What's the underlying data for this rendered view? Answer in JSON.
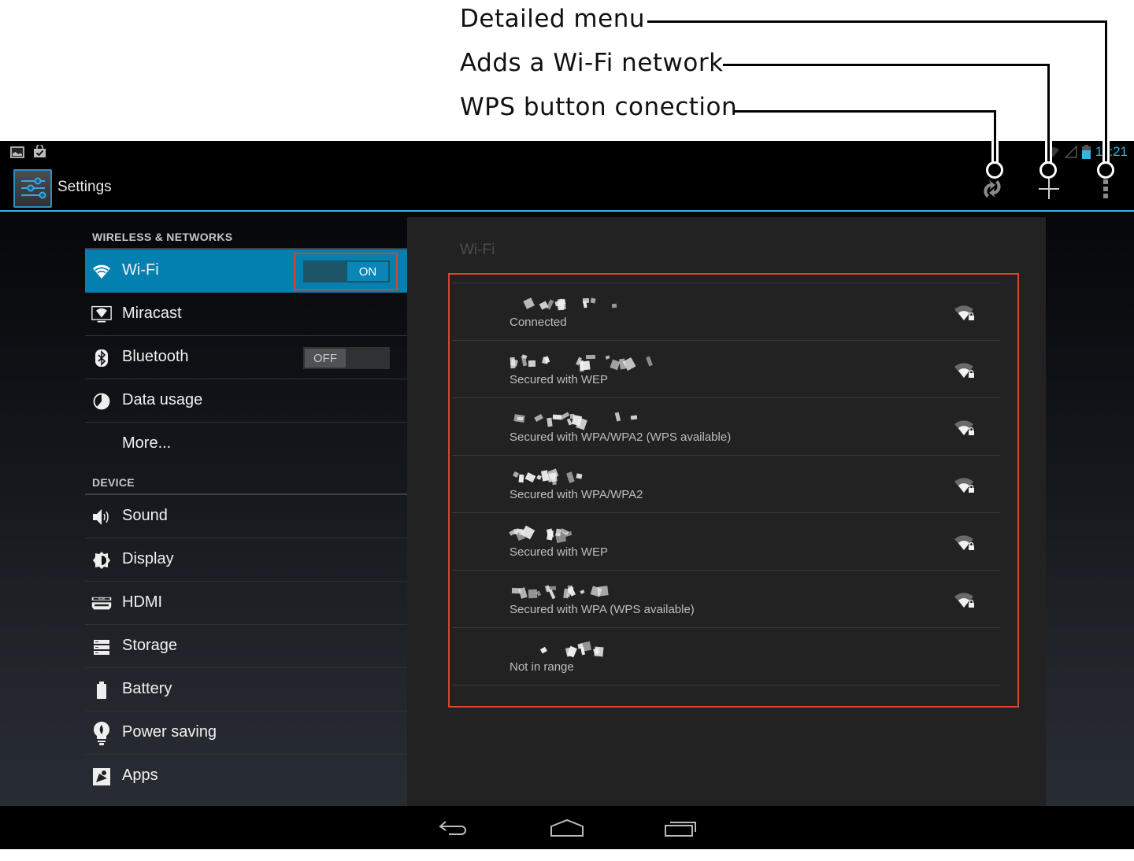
{
  "annotations": [
    {
      "label": "Detailed menu"
    },
    {
      "label": "Adds a Wi-Fi network"
    },
    {
      "label": "WPS button conection"
    }
  ],
  "status_bar": {
    "left_icons": [
      "gallery-icon",
      "shopping-bag-icon"
    ],
    "right_icons": [
      "wifi-signal-icon",
      "cell-signal-icon",
      "battery-icon"
    ],
    "clock": "11:21",
    "accent": "#33b5e5"
  },
  "action_bar": {
    "title": "Settings",
    "actions": [
      {
        "name": "wps-button",
        "icon": "wps-icon"
      },
      {
        "name": "add-network-button",
        "icon": "plus-icon"
      },
      {
        "name": "overflow-menu-button",
        "icon": "more-vertical-icon"
      }
    ]
  },
  "settings": {
    "sections": [
      {
        "header": "WIRELESS & NETWORKS",
        "items": [
          {
            "label": "Wi-Fi",
            "icon": "wifi-icon",
            "toggle": "ON",
            "active": true
          },
          {
            "label": "Miracast",
            "icon": "miracast-icon"
          },
          {
            "label": "Bluetooth",
            "icon": "bluetooth-icon",
            "toggle": "OFF"
          },
          {
            "label": "Data usage",
            "icon": "data-usage-icon"
          },
          {
            "label": "More..."
          }
        ]
      },
      {
        "header": "DEVICE",
        "items": [
          {
            "label": "Sound",
            "icon": "sound-icon"
          },
          {
            "label": "Display",
            "icon": "display-icon"
          },
          {
            "label": "HDMI",
            "icon": "hdmi-icon"
          },
          {
            "label": "Storage",
            "icon": "storage-icon"
          },
          {
            "label": "Battery",
            "icon": "battery-icon"
          },
          {
            "label": "Power saving",
            "icon": "power-saving-icon"
          },
          {
            "label": "Apps",
            "icon": "apps-icon"
          }
        ]
      }
    ]
  },
  "wifi_panel": {
    "title": "Wi-Fi",
    "networks": [
      {
        "ssid_obscured": true,
        "status": "Connected",
        "secured": true,
        "signal": "strong"
      },
      {
        "ssid_obscured": true,
        "status": "Secured with WEP",
        "secured": true,
        "signal": "strong"
      },
      {
        "ssid_obscured": true,
        "status": "Secured with WPA/WPA2 (WPS available)",
        "secured": true,
        "signal": "strong"
      },
      {
        "ssid_obscured": true,
        "status": "Secured with WPA/WPA2",
        "secured": true,
        "signal": "strong"
      },
      {
        "ssid_obscured": true,
        "status": "Secured with WEP",
        "secured": true,
        "signal": "strong"
      },
      {
        "ssid_obscured": true,
        "status": "Secured with WPA (WPS available)",
        "secured": true,
        "signal": "strong"
      },
      {
        "ssid_obscured": true,
        "status": "Not in range",
        "secured": false,
        "signal": "none"
      }
    ],
    "highlight_color": "#d9442f"
  },
  "nav_bar": {
    "buttons": [
      "back-icon",
      "home-icon",
      "recent-apps-icon"
    ]
  }
}
